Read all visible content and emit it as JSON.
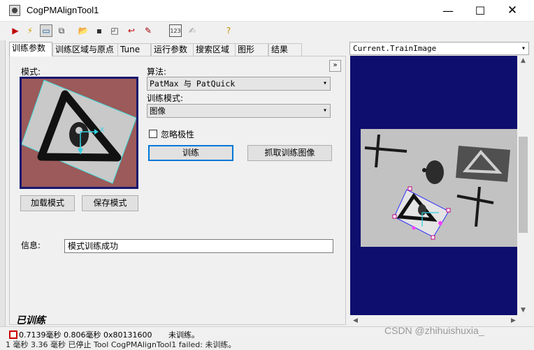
{
  "window": {
    "title": "CogPMAlignTool1",
    "minimize": "—",
    "maximize": "☐",
    "close": "✕"
  },
  "toolbar": [
    {
      "name": "run-icon",
      "glyph": "▶",
      "color": "#c00000"
    },
    {
      "name": "electric-icon",
      "glyph": "⚡",
      "color": "#d4a000"
    },
    {
      "name": "display-icon",
      "glyph": "▭",
      "color": "#2060a0"
    },
    {
      "name": "show-results-icon",
      "glyph": "⧉",
      "color": "#404040"
    },
    {
      "name": "open-icon",
      "glyph": "📂",
      "color": "#c09020"
    },
    {
      "name": "save-icon",
      "glyph": "▪",
      "color": "#303030"
    },
    {
      "name": "save-as-icon",
      "glyph": "◰",
      "color": "#303030"
    },
    {
      "name": "reset-icon",
      "glyph": "↩",
      "color": "#c00000"
    },
    {
      "name": "tool-icon",
      "glyph": "✎",
      "color": "#a00000"
    },
    {
      "name": "counter-icon",
      "glyph": "123",
      "color": "#303030"
    },
    {
      "name": "edit-disabled-icon",
      "glyph": "✍",
      "color": "#a0a0a0"
    },
    {
      "name": "help-icon",
      "glyph": "?",
      "color": "#c09000"
    }
  ],
  "tabs": [
    {
      "label": "训练参数",
      "active": true
    },
    {
      "label": "训练区域与原点",
      "active": false
    },
    {
      "label": "Tune",
      "active": false
    },
    {
      "label": "运行参数",
      "active": false
    },
    {
      "label": "搜索区域",
      "active": false
    },
    {
      "label": "图形",
      "active": false
    },
    {
      "label": "结果",
      "active": false
    }
  ],
  "train_params": {
    "model_label": "模式:",
    "algorithm_label": "算法:",
    "algorithm_value": "PatMax 与 PatQuick",
    "train_mode_label": "训练模式:",
    "train_mode_value": "图像",
    "ignore_polarity_label": "忽略极性",
    "ignore_polarity_checked": false,
    "train_button": "训练",
    "grab_train_image_button": "抓取训练图像",
    "load_model_button": "加载模式",
    "save_model_button": "保存模式",
    "expand_button": "»",
    "info_label": "信息:",
    "info_value": "模式训练成功"
  },
  "trained_status": "已训练",
  "statusbar": {
    "timing": "0.7139毫秒 0.806毫秒 0x80131600",
    "message": "未训练。",
    "ghost_text": "1 毫秒  3.36 毫秒  已停止     Tool  CogPMAlignTool1  failed: 未训练。"
  },
  "display": {
    "image_selector": "Current.TrainImage"
  },
  "watermark": "CSDN @zhihuishuxia_"
}
